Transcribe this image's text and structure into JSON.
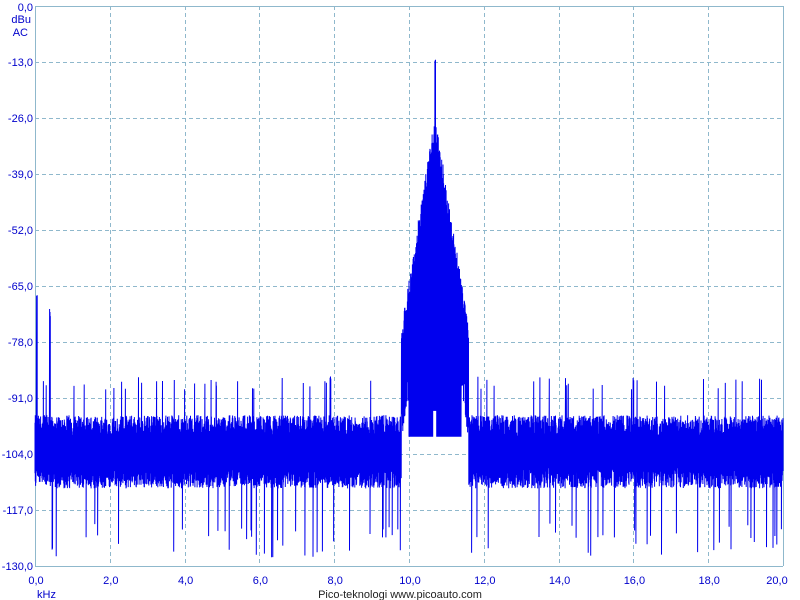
{
  "chart_data": {
    "type": "line",
    "title": "",
    "ylabel_lines": [
      "dBu",
      "AC"
    ],
    "xlabel": "kHz",
    "footer": "Pico-teknologi   www.picoauto.com",
    "xlim": [
      0.0,
      20.0
    ],
    "ylim": [
      -130.0,
      0.0
    ],
    "x_ticks": [
      "0,0",
      "2,0",
      "4,0",
      "6,0",
      "8,0",
      "10,0",
      "12,0",
      "14,0",
      "16,0",
      "18,0",
      "20,0"
    ],
    "x_tick_values": [
      0,
      2,
      4,
      6,
      8,
      10,
      12,
      14,
      16,
      18,
      20
    ],
    "y_ticks": [
      "0,0",
      "-13,0",
      "-26,0",
      "-39,0",
      "-52,0",
      "-65,0",
      "-78,0",
      "-91,0",
      "-104,0",
      "-117,0",
      "-130,0"
    ],
    "y_tick_values": [
      0,
      -13,
      -26,
      -39,
      -52,
      -65,
      -78,
      -91,
      -104,
      -117,
      -130
    ],
    "grid": true,
    "series": [
      {
        "color": "#0000ee",
        "noise_floor_top_dBu": -95,
        "noise_floor_bottom_dBu": -112,
        "noise_spikes_up_to_dBu": -89,
        "noise_dips_down_to_dBu": -128,
        "peaks": [
          {
            "x": 10.7,
            "y": -13.0
          },
          {
            "x": 0.05,
            "y": -69.0
          },
          {
            "x": 0.4,
            "y": -72.0
          },
          {
            "x": 7.9,
            "y": -88.0
          },
          {
            "x": 16.0,
            "y": -88.0
          }
        ],
        "notch": {
          "x": 10.7,
          "y": -103.0
        }
      }
    ]
  },
  "colors": {
    "axis_text": "#0000cc",
    "grid": "#8fb8cc",
    "trace": "#0000ee",
    "background": "#ffffff"
  }
}
